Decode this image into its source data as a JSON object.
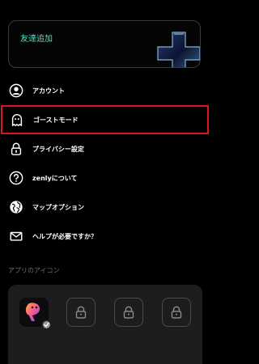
{
  "add_friend_card": {
    "title": "友達追加"
  },
  "menu": {
    "items": [
      {
        "label": "アカウント",
        "icon": "person-circle-icon"
      },
      {
        "label": "ゴーストモード",
        "icon": "ghost-icon",
        "highlighted": true
      },
      {
        "label": "プライバシー設定",
        "icon": "lock-icon"
      },
      {
        "label": "zenlyについて",
        "icon": "question-circle-icon"
      },
      {
        "label": "マップオプション",
        "icon": "globe-icon"
      },
      {
        "label": "ヘルプが必要ですか？",
        "icon": "envelope-icon"
      }
    ]
  },
  "app_icons": {
    "section_label": "アプリのアイコン",
    "icons": [
      {
        "name": "current-app-icon",
        "selected": true
      },
      {
        "name": "locked-app-icon",
        "locked": true
      },
      {
        "name": "locked-app-icon",
        "locked": true
      },
      {
        "name": "locked-app-icon",
        "locked": true
      }
    ]
  },
  "colors": {
    "highlight": "#e0141a",
    "title_accent": "#4fe0c8",
    "background": "#000000"
  }
}
